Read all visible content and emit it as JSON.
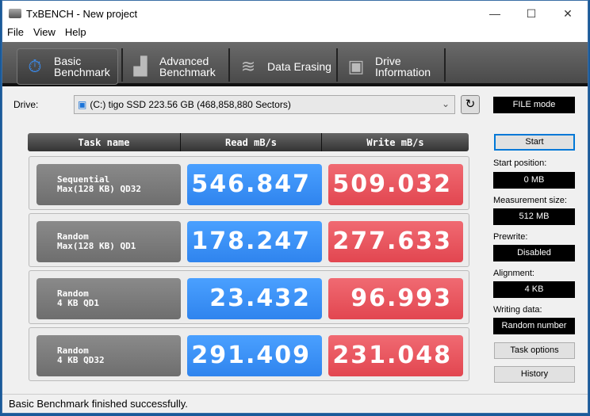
{
  "window": {
    "title": "TxBENCH - New project",
    "minimize": "—",
    "maximize": "☐",
    "close": "✕"
  },
  "menu": [
    "File",
    "View",
    "Help"
  ],
  "tabs": [
    {
      "label1": "Basic",
      "label2": "Benchmark",
      "icon": "stopwatch-icon"
    },
    {
      "label1": "Advanced",
      "label2": "Benchmark",
      "icon": "bar-chart-icon"
    },
    {
      "label1": "Data Erasing",
      "label2": "",
      "icon": "eraser-icon"
    },
    {
      "label1": "Drive",
      "label2": "Information",
      "icon": "drive-info-icon"
    }
  ],
  "drive": {
    "label": "Drive:",
    "value": "(C:) tigo SSD  223.56 GB (468,858,880 Sectors)"
  },
  "table": {
    "headers": [
      "Task name",
      "Read mB/s",
      "Write mB/s"
    ],
    "rows": [
      {
        "task": "Sequential\nMax(128 KB) QD32",
        "read": "546.847",
        "write": "509.032"
      },
      {
        "task": "Random\nMax(128 KB) QD1",
        "read": "178.247",
        "write": "277.633"
      },
      {
        "task": "Random\n4 KB QD1",
        "read": "23.432",
        "write": "96.993"
      },
      {
        "task": "Random\n4 KB QD32",
        "read": "291.409",
        "write": "231.048"
      }
    ]
  },
  "side": {
    "mode": "FILE mode",
    "start": "Start",
    "start_position_label": "Start position:",
    "start_position": "0 MB",
    "measurement_size_label": "Measurement size:",
    "measurement_size": "512 MB",
    "prewrite_label": "Prewrite:",
    "prewrite": "Disabled",
    "alignment_label": "Alignment:",
    "alignment": "4 KB",
    "writing_data_label": "Writing data:",
    "writing_data": "Random number",
    "task_options": "Task options",
    "history": "History"
  },
  "status": "Basic Benchmark finished successfully.",
  "colors": {
    "read": "#3a8ff5",
    "write": "#e9545d",
    "toolbar": "#555555"
  }
}
